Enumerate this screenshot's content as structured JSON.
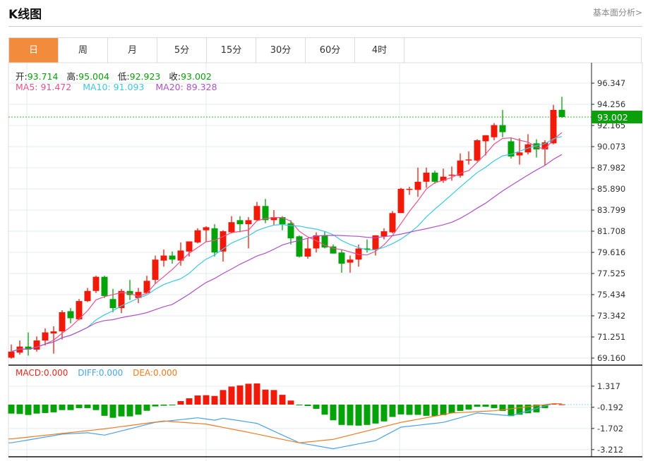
{
  "header": {
    "title": "K线图",
    "link": "基本面分析>"
  },
  "tabs": [
    {
      "label": "日",
      "active": true
    },
    {
      "label": "周"
    },
    {
      "label": "月"
    },
    {
      "label": "5分"
    },
    {
      "label": "15分"
    },
    {
      "label": "30分"
    },
    {
      "label": "60分"
    },
    {
      "label": "4时"
    }
  ],
  "ohlc": {
    "open_label": "开:",
    "open": "93.714",
    "high_label": "高:",
    "high": "95.004",
    "low_label": "低:",
    "low": "92.923",
    "close_label": "收:",
    "close": "93.002"
  },
  "ma": {
    "ma5": "MA5: 91.472",
    "ma10": "MA10: 91.093",
    "ma20": "MA20: 89.328"
  },
  "macd_legend": {
    "macd": "MACD:0.000",
    "diff": "DIFF:0.000",
    "dea": "DEA:0.000"
  },
  "current_price": "93.002",
  "colors": {
    "up": "#f01a0a",
    "down": "#06a20a",
    "ma5": "#f0508a",
    "ma10": "#3cc8e0",
    "ma20": "#b050c8",
    "diff": "#4aa3e8",
    "dea": "#f07a20",
    "tab_active": "#f28c3c"
  },
  "chart_data": {
    "type": "candlestick",
    "price_ticks": [
      "96.347",
      "94.256",
      "92.165",
      "90.073",
      "87.982",
      "85.890",
      "83.799",
      "81.708",
      "79.616",
      "77.525",
      "75.434",
      "73.342",
      "71.251",
      "69.160"
    ],
    "price_range": [
      69.16,
      96.347
    ],
    "macd_ticks": [
      "1.317",
      "-0.192",
      "-1.702",
      "-3.212"
    ],
    "candles": [
      [
        69.2,
        69.8,
        70.5,
        69.1
      ],
      [
        69.7,
        70.3,
        70.9,
        69.5
      ],
      [
        70.3,
        70.0,
        71.7,
        69.4
      ],
      [
        70.0,
        70.9,
        71.3,
        69.8
      ],
      [
        70.9,
        71.7,
        72.1,
        70.4
      ],
      [
        71.6,
        71.8,
        72.3,
        69.6
      ],
      [
        71.8,
        73.7,
        73.9,
        71.0
      ],
      [
        73.8,
        73.1,
        74.1,
        72.6
      ],
      [
        73.0,
        74.8,
        75.0,
        72.9
      ],
      [
        74.8,
        75.8,
        76.1,
        74.7
      ],
      [
        75.8,
        77.2,
        77.3,
        75.6
      ],
      [
        77.2,
        75.3,
        77.3,
        75.1
      ],
      [
        75.0,
        74.1,
        76.0,
        73.7
      ],
      [
        74.1,
        75.8,
        76.0,
        73.6
      ],
      [
        75.8,
        75.4,
        76.9,
        74.9
      ],
      [
        75.1,
        75.7,
        76.1,
        74.6
      ],
      [
        75.6,
        76.8,
        77.3,
        75.5
      ],
      [
        76.9,
        78.9,
        79.3,
        76.5
      ],
      [
        78.8,
        79.3,
        79.9,
        78.2
      ],
      [
        79.3,
        78.9,
        79.7,
        78.5
      ],
      [
        78.8,
        79.8,
        80.6,
        78.3
      ],
      [
        79.7,
        80.7,
        80.7,
        79.2
      ],
      [
        80.6,
        81.8,
        82.0,
        80.5
      ],
      [
        81.8,
        82.1,
        82.2,
        80.7
      ],
      [
        82.0,
        79.6,
        82.4,
        79.2
      ],
      [
        79.7,
        81.7,
        81.8,
        78.7
      ],
      [
        81.6,
        82.6,
        83.2,
        81.5
      ],
      [
        82.8,
        82.4,
        83.2,
        81.6
      ],
      [
        82.4,
        82.8,
        83.1,
        80.0
      ],
      [
        82.8,
        84.2,
        84.6,
        82.7
      ],
      [
        84.2,
        82.8,
        84.9,
        82.5
      ],
      [
        82.8,
        83.1,
        83.8,
        82.3
      ],
      [
        83.1,
        82.4,
        83.2,
        81.8
      ],
      [
        82.5,
        81.0,
        82.8,
        80.4
      ],
      [
        81.2,
        79.2,
        81.3,
        79.1
      ],
      [
        79.2,
        80.0,
        81.0,
        79.0
      ],
      [
        80.0,
        81.3,
        81.6,
        79.6
      ],
      [
        81.3,
        80.1,
        81.7,
        80.0
      ],
      [
        80.2,
        79.5,
        80.4,
        79.5
      ],
      [
        79.6,
        78.5,
        79.9,
        77.6
      ],
      [
        78.6,
        78.9,
        79.3,
        77.6
      ],
      [
        78.9,
        80.0,
        80.4,
        78.2
      ],
      [
        80.0,
        79.9,
        80.9,
        79.6
      ],
      [
        79.9,
        81.3,
        81.3,
        79.3
      ],
      [
        81.2,
        81.7,
        82.0,
        80.9
      ],
      [
        81.6,
        83.5,
        83.7,
        81.5
      ],
      [
        83.5,
        85.9,
        86.0,
        83.5
      ],
      [
        85.8,
        85.9,
        86.1,
        85.3
      ],
      [
        85.8,
        86.6,
        88.0,
        85.1
      ],
      [
        86.6,
        87.5,
        88.0,
        86.0
      ],
      [
        87.5,
        86.6,
        87.7,
        86.4
      ],
      [
        86.7,
        87.1,
        87.9,
        86.5
      ],
      [
        87.2,
        87.3,
        88.1,
        86.7
      ],
      [
        87.2,
        88.7,
        89.4,
        87.0
      ],
      [
        88.7,
        88.8,
        89.6,
        88.3
      ],
      [
        88.7,
        90.7,
        90.8,
        88.6
      ],
      [
        90.6,
        91.2,
        91.2,
        89.2
      ],
      [
        91.0,
        92.2,
        92.4,
        90.7
      ],
      [
        92.2,
        91.5,
        93.7,
        91.0
      ],
      [
        90.6,
        89.1,
        91.0,
        88.9
      ],
      [
        89.2,
        89.5,
        90.9,
        88.3
      ],
      [
        89.5,
        90.3,
        91.3,
        89.3
      ],
      [
        90.4,
        89.8,
        90.8,
        89.0
      ],
      [
        89.8,
        90.5,
        90.7,
        88.2
      ],
      [
        90.4,
        93.7,
        94.2,
        90.3
      ],
      [
        93.714,
        93.002,
        95.004,
        92.923
      ]
    ],
    "macd_hist": [
      -0.64,
      -0.67,
      -0.74,
      -0.64,
      -0.6,
      -0.55,
      -0.39,
      -0.39,
      -0.25,
      -0.25,
      -0.39,
      -0.8,
      -0.94,
      -0.84,
      -0.84,
      -0.72,
      -0.44,
      -0.13,
      -0.08,
      -0.02,
      0.25,
      0.45,
      0.65,
      0.67,
      0.62,
      1.04,
      1.29,
      1.37,
      1.49,
      1.51,
      1.07,
      1.04,
      0.7,
      0.29,
      -0.02,
      -0.1,
      -0.3,
      -0.72,
      -1.12,
      -1.45,
      -1.48,
      -1.5,
      -1.45,
      -1.35,
      -1.2,
      -0.88,
      -0.7,
      -0.73,
      -0.73,
      -0.8,
      -0.82,
      -0.75,
      -0.6,
      -0.45,
      -0.35,
      -0.15,
      -0.15,
      -0.25,
      -0.45,
      -0.82,
      -0.72,
      -0.62,
      -0.55,
      -0.25,
      0.05,
      0.02
    ],
    "dea_points": [
      [
        0,
        -2.45
      ],
      [
        11,
        -1.73
      ],
      [
        18,
        -1.17
      ],
      [
        23,
        -1.39
      ],
      [
        28,
        -1.98
      ],
      [
        34,
        -2.73
      ],
      [
        38,
        -2.48
      ],
      [
        46,
        -1.27
      ],
      [
        52,
        -0.6
      ],
      [
        57,
        -0.44
      ],
      [
        64,
        0.07
      ],
      [
        65,
        0.05
      ]
    ],
    "diff_points": [
      [
        0,
        -2.73
      ],
      [
        6,
        -2.11
      ],
      [
        9,
        -2.01
      ],
      [
        11,
        -2.18
      ],
      [
        17,
        -1.27
      ],
      [
        22,
        -0.94
      ],
      [
        24,
        -1.11
      ],
      [
        25,
        -0.97
      ],
      [
        29,
        -1.34
      ],
      [
        34,
        -2.73
      ],
      [
        38,
        -3.15
      ],
      [
        43,
        -2.57
      ],
      [
        46,
        -1.61
      ],
      [
        51,
        -1.27
      ],
      [
        55,
        -0.6
      ],
      [
        59,
        -0.8
      ],
      [
        64,
        0.07
      ],
      [
        65,
        0.05
      ]
    ]
  }
}
